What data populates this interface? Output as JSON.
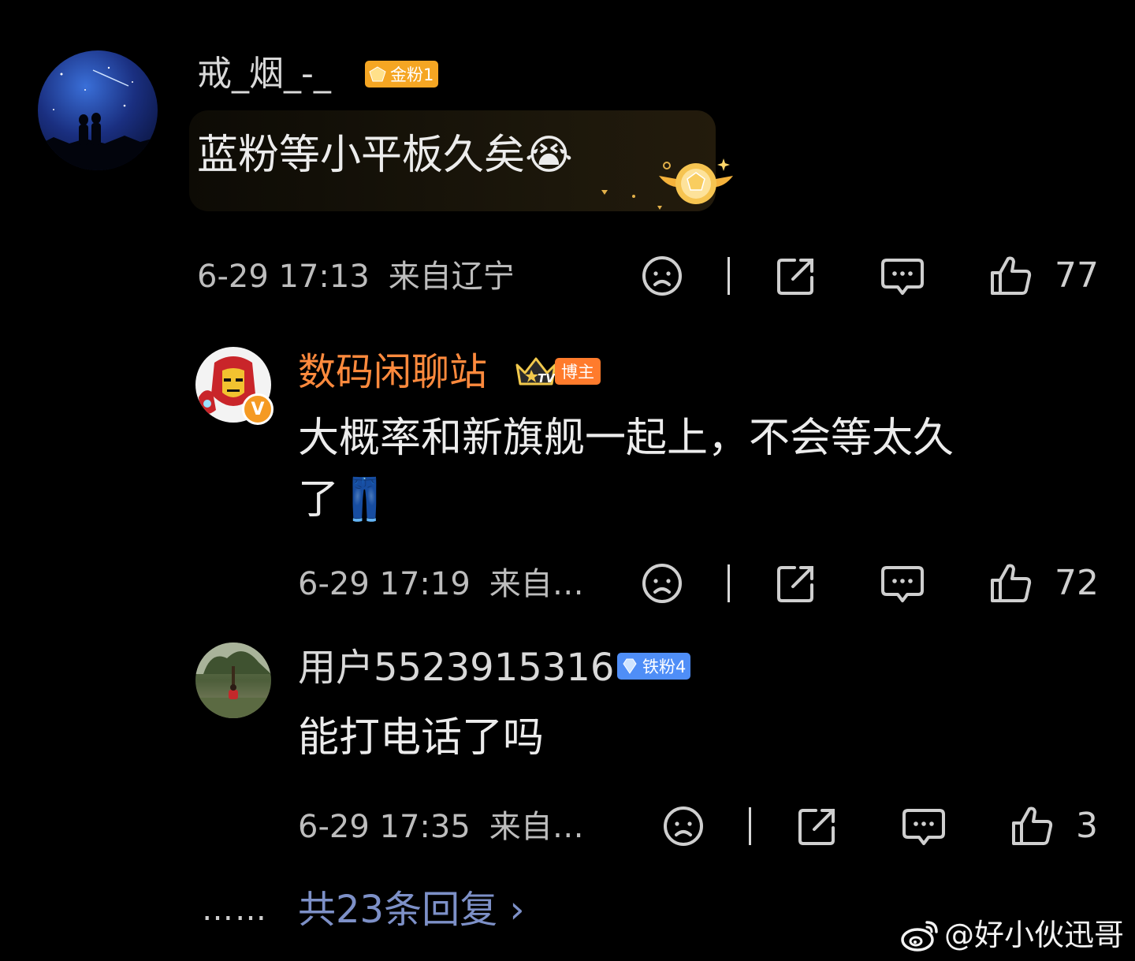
{
  "comments": [
    {
      "username": "戒_烟_-_",
      "username_color": "#d9d9d9",
      "badge": {
        "label": "金粉1",
        "color": "#f5a623",
        "icon": "gold-gem-icon"
      },
      "text": "蓝粉等小平板久矣😭",
      "time": "6-29 17:13",
      "location": "来自辽宁",
      "likes": "77"
    },
    {
      "username": "数码闲聊站",
      "username_color": "#ff8a3d",
      "crown_text": "TV",
      "badge": {
        "label": "博主",
        "color": "#ff7b2c",
        "icon": "crown-icon"
      },
      "text_lines": [
        "大概率和新旗舰一起上，不会等太久",
        "了👖"
      ],
      "time": "6-29 17:19",
      "location": "来自…",
      "likes": "72",
      "verified_mark": "V"
    },
    {
      "username": "用户5523915316",
      "username_color": "#d9d9d9",
      "badge": {
        "label": "铁粉4",
        "color": "#4f8ef7",
        "icon": "diamond-icon"
      },
      "text": "能打电话了吗",
      "time": "6-29 17:35",
      "location": "来自…",
      "likes": "3"
    }
  ],
  "footer": {
    "dots": "……",
    "more_replies": "共23条回复 ›"
  },
  "watermark": "@好小伙迅哥",
  "colors": {
    "background": "#000000",
    "link": "#7d90c7",
    "text": "#ececec",
    "meta": "#bdbdbd"
  }
}
